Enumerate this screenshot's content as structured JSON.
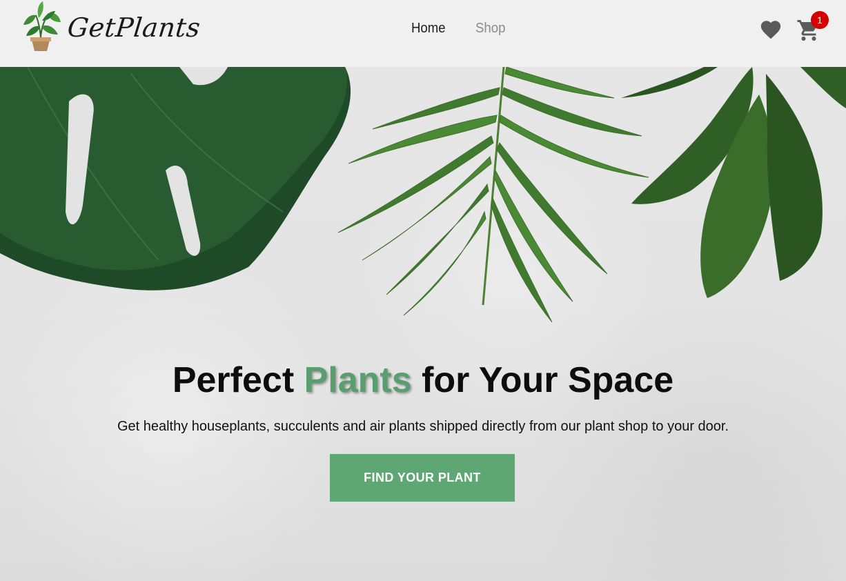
{
  "brand": {
    "name": "GetPlants",
    "logo_icon": "potted-plant-icon"
  },
  "nav": {
    "links": [
      {
        "label": "Home",
        "state": "active"
      },
      {
        "label": "Shop",
        "state": "inactive"
      }
    ]
  },
  "actions": {
    "wishlist_icon": "heart-icon",
    "cart_icon": "cart-icon",
    "cart_count": "1"
  },
  "hero": {
    "title_before": "Perfect ",
    "title_accent": "Plants",
    "title_after": " for Your Space",
    "subtitle": "Get healthy houseplants, succulents and air plants shipped directly from our plant shop to your door.",
    "cta_label": "FIND YOUR PLANT"
  },
  "colors": {
    "accent": "#5ea672",
    "title_accent": "#5a9e6f",
    "badge": "#d50000",
    "navbar_bg": "#f0f0f0"
  }
}
